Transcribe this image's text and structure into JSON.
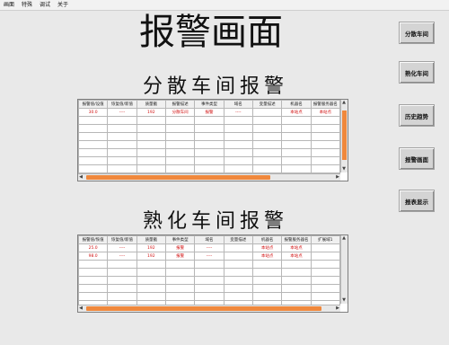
{
  "menu": [
    "画面",
    "特殊",
    "调试",
    "关于"
  ],
  "title": "报警画面",
  "sections": {
    "dispersed": {
      "title": "分散车间报警",
      "headers": [
        "报警值/设值",
        "恢复值/新值",
        "质量戳",
        "报警描述",
        "事件类型",
        "域名",
        "变量描述",
        "机器名",
        "报警服务器名"
      ],
      "rows": [
        [
          "30.0",
          "----",
          "192",
          "分散车间",
          "报警",
          "----",
          "",
          "本站点",
          "本站点"
        ]
      ]
    },
    "cooked": {
      "title": "熟化车间报警",
      "headers": [
        "报警值/恢值",
        "恢复值/新值",
        "质量戳",
        "事件类型",
        "域名",
        "变量描述",
        "机器名",
        "报警服务器名",
        "扩展域1"
      ],
      "rows": [
        [
          "25.0",
          "----",
          "192",
          "报警",
          "----",
          "",
          "本站点",
          "本站点",
          ""
        ],
        [
          "98.0",
          "----",
          "192",
          "报警",
          "----",
          "",
          "本站点",
          "本站点",
          ""
        ]
      ]
    }
  },
  "buttons": [
    "分散车间",
    "熟化车间",
    "历史趋势",
    "报警画面",
    "报表显示"
  ],
  "colors": {
    "accent": "#f0883c",
    "alarm_text": "#d21414"
  }
}
